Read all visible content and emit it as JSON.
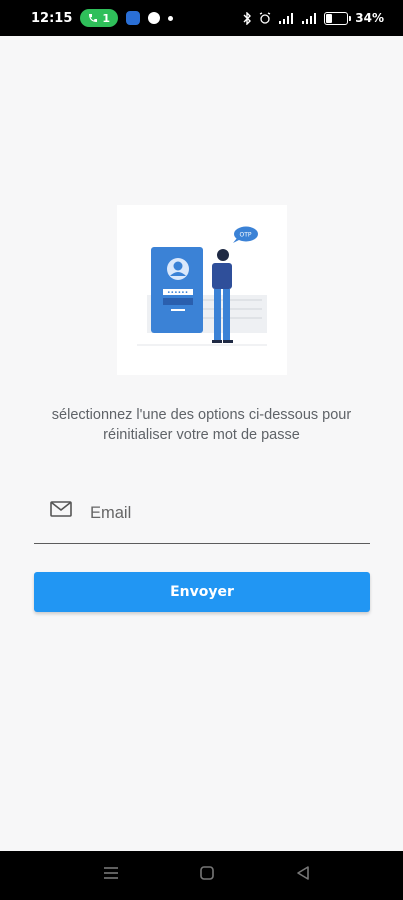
{
  "status_bar": {
    "time": "12:15",
    "notif_count": "1",
    "battery": "34%",
    "battery_level": 0.34
  },
  "main": {
    "subtitle": "sélectionnez l'une des options ci-dessous pour réinitialiser votre mot de passe",
    "email_placeholder": "Email",
    "email_value": "",
    "submit_label": "Envoyer"
  },
  "illustration": {
    "password_mask": "••••••",
    "speech_bubble": "OTP"
  },
  "icons": {
    "mail": "mail-icon",
    "nav_menu": "recent-apps-icon",
    "nav_home": "home-icon",
    "nav_back": "back-icon"
  },
  "colors": {
    "accent": "#2196f3",
    "status_pill": "#2fbf5a"
  }
}
